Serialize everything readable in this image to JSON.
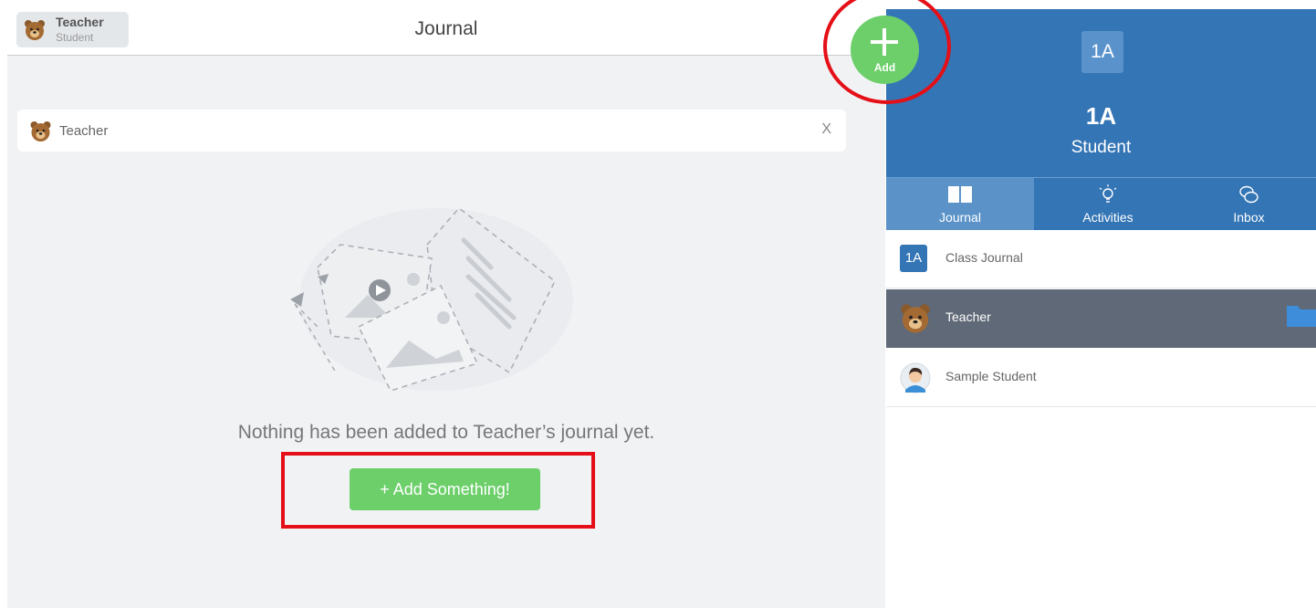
{
  "header": {
    "user_name": "Teacher",
    "user_role": "Student",
    "title": "Journal"
  },
  "filter": {
    "name": "Teacher",
    "close_label": "X"
  },
  "empty_state": {
    "message": "Nothing has been added to Teacher’s journal yet.",
    "button_label": "+ Add Something!"
  },
  "fab": {
    "label": "Add"
  },
  "class": {
    "badge": "1A",
    "name": "1A",
    "role": "Student"
  },
  "tabs": [
    {
      "label": "Journal",
      "icon": "book-icon",
      "active": true
    },
    {
      "label": "Activities",
      "icon": "lightbulb-icon",
      "active": false
    },
    {
      "label": "Inbox",
      "icon": "chat-bubbles-icon",
      "active": false
    }
  ],
  "list": [
    {
      "label": "Class Journal",
      "badge": "1A",
      "type": "class"
    },
    {
      "label": "Teacher",
      "type": "bear-avatar",
      "selected": true
    },
    {
      "label": "Sample Student",
      "type": "student-avatar"
    }
  ],
  "colors": {
    "brand_blue": "#3475b5",
    "green": "#6ccf6a",
    "annotation_red": "#e50f17",
    "selected_row": "#5f6977"
  }
}
